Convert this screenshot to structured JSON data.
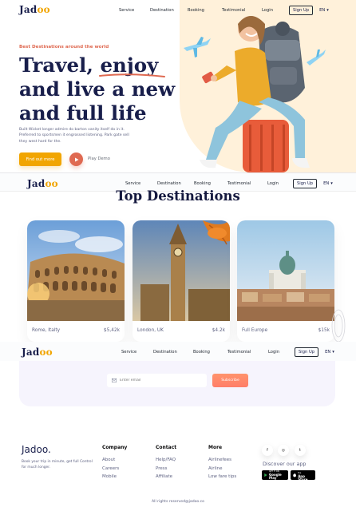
{
  "brand": {
    "logo_main": "Jad",
    "logo_accent": "oo"
  },
  "nav": {
    "items": [
      "Service",
      "Destination",
      "Booking",
      "Testimonial",
      "Login"
    ],
    "signup": "Sign Up",
    "lang": "EN"
  },
  "hero": {
    "subtitle": "Best Destinations around the world",
    "title_line1_a": "Travel,",
    "title_line1_b": "enjoy",
    "title_line2": "and live a new",
    "title_line3": "and full life",
    "description": "Built Wicket longer admire do barton vanity itself do in it. Preferred to sportsmen it engrossed listening. Park gate sell they west hard for the.",
    "find_out_label": "Find out more",
    "play_label": "Play Demo"
  },
  "destinations": {
    "title": "Top Destinations",
    "cards": [
      {
        "name": "Rome, Italty",
        "price": "$5,42k"
      },
      {
        "name": "London, UK",
        "price": "$4.2k"
      },
      {
        "name": "Full Europe",
        "price": "$15k"
      }
    ]
  },
  "subscribe": {
    "email_placeholder": "Enter email",
    "button_label": "Subscribe"
  },
  "footer": {
    "logo": "Jadoo.",
    "tagline": "Book your trip in minute, get full Control for much longer.",
    "columns": [
      {
        "heading": "Company",
        "items": [
          "About",
          "Careers",
          "Mobile"
        ]
      },
      {
        "heading": "Contact",
        "items": [
          "Help/FAQ",
          "Press",
          "Affiliate"
        ]
      },
      {
        "heading": "More",
        "items": [
          "Airlinefees",
          "Airline",
          "Low fare tips"
        ]
      }
    ],
    "socials": [
      "f",
      "◎",
      "t"
    ],
    "discover": "Discover our app",
    "google_small": "GET IT ON",
    "google_big": "Google Play",
    "apple_small": "Available on the",
    "apple_big": "App Store",
    "copyright": "All rights reserved@jadoo.co"
  },
  "colors": {
    "accent_yellow": "#f1a501",
    "accent_orange": "#df6951",
    "navy": "#181e4b"
  }
}
